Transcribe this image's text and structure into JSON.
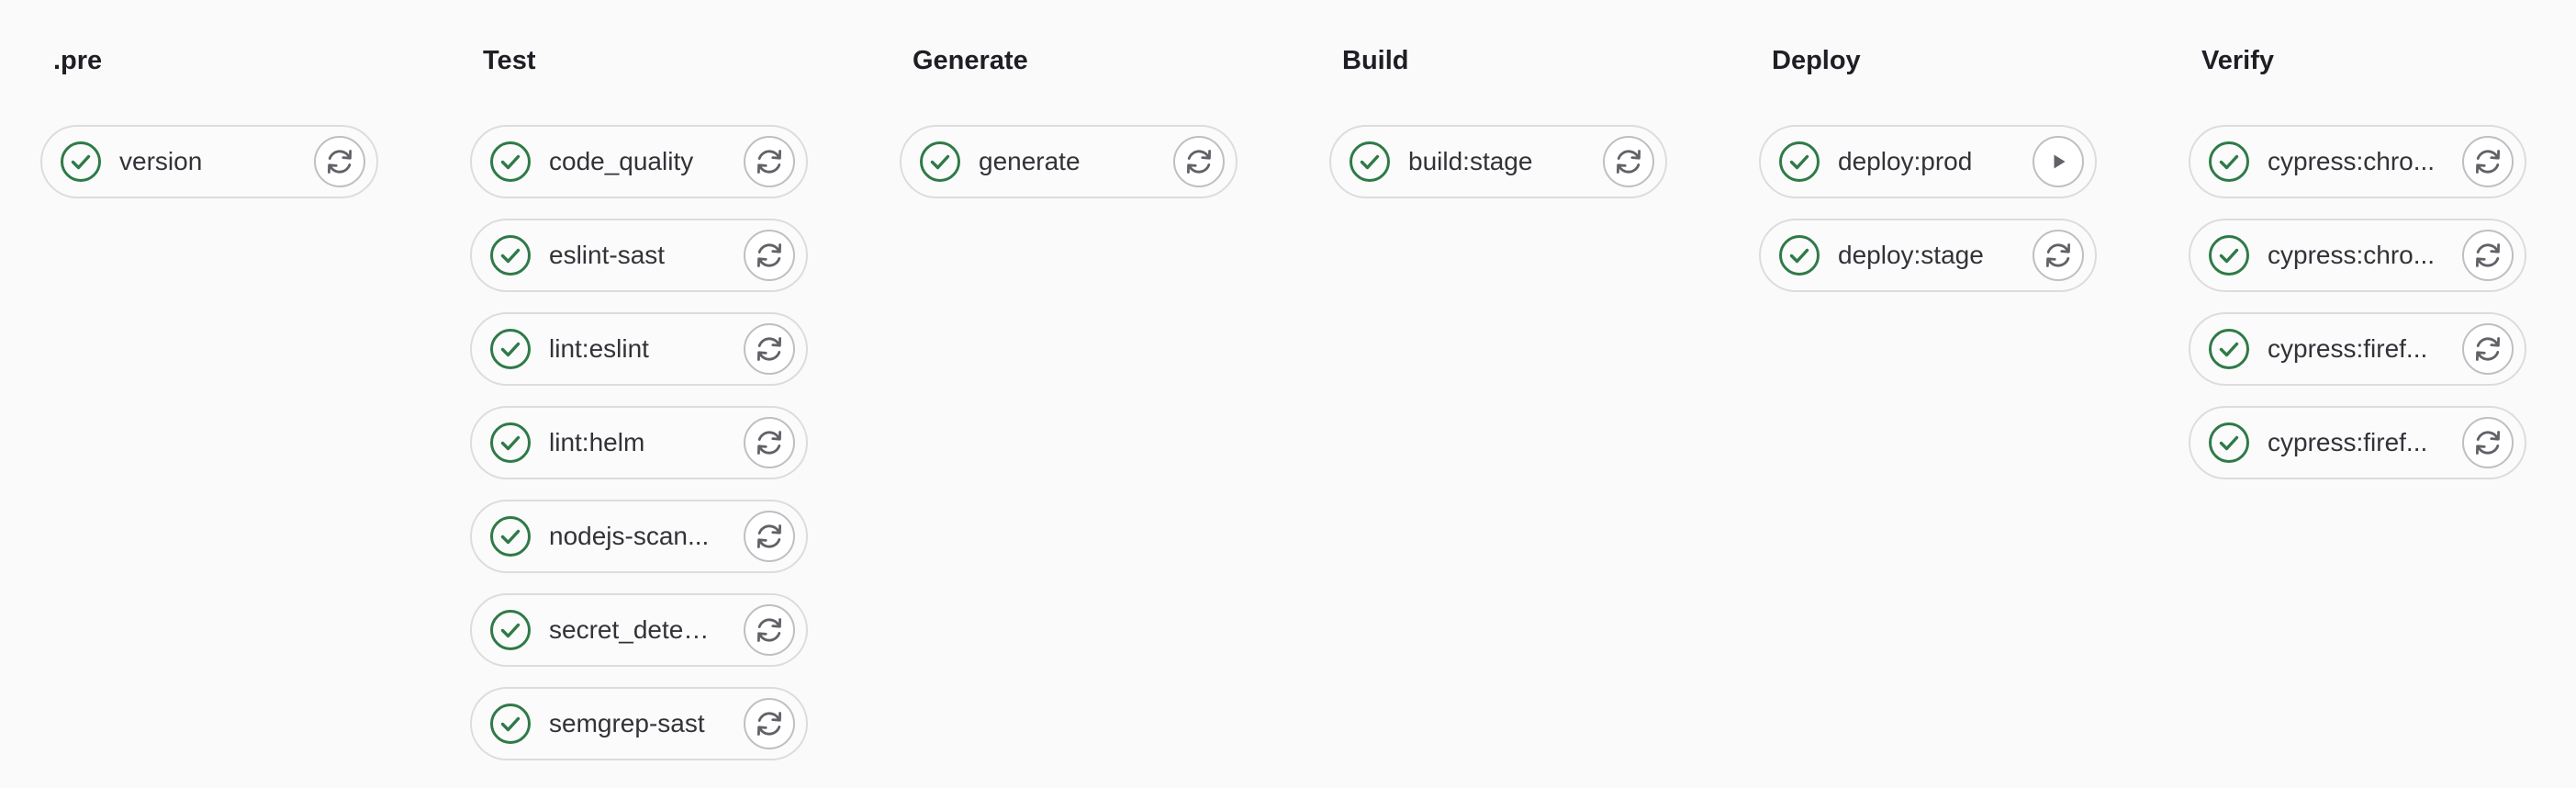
{
  "colors": {
    "success": "#2f7a48",
    "action_icon": "#626168",
    "border": "#dcdcde"
  },
  "stages": [
    {
      "title": ".pre",
      "jobs": [
        {
          "name": "version",
          "status": "success",
          "status_icon": "check-circle-icon",
          "action": "retry",
          "action_icon": "retry-icon"
        }
      ]
    },
    {
      "title": "Test",
      "jobs": [
        {
          "name": "code_quality",
          "status": "success",
          "status_icon": "check-circle-icon",
          "action": "retry",
          "action_icon": "retry-icon"
        },
        {
          "name": "eslint-sast",
          "status": "success",
          "status_icon": "check-circle-icon",
          "action": "retry",
          "action_icon": "retry-icon"
        },
        {
          "name": "lint:eslint",
          "status": "success",
          "status_icon": "check-circle-icon",
          "action": "retry",
          "action_icon": "retry-icon"
        },
        {
          "name": "lint:helm",
          "status": "success",
          "status_icon": "check-circle-icon",
          "action": "retry",
          "action_icon": "retry-icon"
        },
        {
          "name": "nodejs-scan...",
          "status": "success",
          "status_icon": "check-circle-icon",
          "action": "retry",
          "action_icon": "retry-icon"
        },
        {
          "name": "secret_detecti...",
          "status": "success",
          "status_icon": "check-circle-icon",
          "action": "retry",
          "action_icon": "retry-icon"
        },
        {
          "name": "semgrep-sast",
          "status": "success",
          "status_icon": "check-circle-icon",
          "action": "retry",
          "action_icon": "retry-icon"
        }
      ]
    },
    {
      "title": "Generate",
      "jobs": [
        {
          "name": "generate",
          "status": "success",
          "status_icon": "check-circle-icon",
          "action": "retry",
          "action_icon": "retry-icon"
        }
      ]
    },
    {
      "title": "Build",
      "jobs": [
        {
          "name": "build:stage",
          "status": "success",
          "status_icon": "check-circle-icon",
          "action": "retry",
          "action_icon": "retry-icon"
        }
      ]
    },
    {
      "title": "Deploy",
      "jobs": [
        {
          "name": "deploy:prod",
          "status": "success",
          "status_icon": "check-circle-icon",
          "action": "play",
          "action_icon": "play-icon"
        },
        {
          "name": "deploy:stage",
          "status": "success",
          "status_icon": "check-circle-icon",
          "action": "retry",
          "action_icon": "retry-icon"
        }
      ]
    },
    {
      "title": "Verify",
      "jobs": [
        {
          "name": "cypress:chro...",
          "status": "success",
          "status_icon": "check-circle-icon",
          "action": "retry",
          "action_icon": "retry-icon"
        },
        {
          "name": "cypress:chro...",
          "status": "success",
          "status_icon": "check-circle-icon",
          "action": "retry",
          "action_icon": "retry-icon"
        },
        {
          "name": "cypress:firef...",
          "status": "success",
          "status_icon": "check-circle-icon",
          "action": "retry",
          "action_icon": "retry-icon"
        },
        {
          "name": "cypress:firef...",
          "status": "success",
          "status_icon": "check-circle-icon",
          "action": "retry",
          "action_icon": "retry-icon"
        }
      ]
    }
  ]
}
